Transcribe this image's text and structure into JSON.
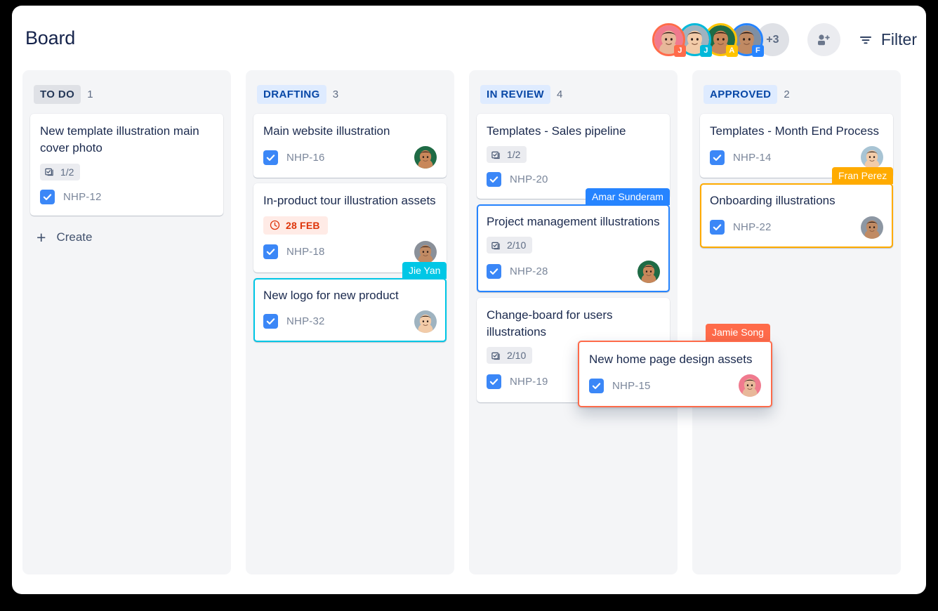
{
  "header": {
    "title": "Board",
    "filter_label": "Filter",
    "more_members": "+3",
    "members": [
      {
        "initial": "J",
        "ring": "#FF6B4A",
        "badge": "#FF6B4A",
        "skin": "#e8b89a",
        "hair": "#2b1a16",
        "bg": "#f07a8e"
      },
      {
        "initial": "J",
        "ring": "#00B8D9",
        "badge": "#00B8D9",
        "skin": "#f2cba8",
        "hair": "#1d1411",
        "bg": "#9fb3c0"
      },
      {
        "initial": "A",
        "ring": "#FFC400",
        "badge": "#FFC400",
        "skin": "#c8875a",
        "hair": "#241512",
        "bg": "#1f6b45"
      },
      {
        "initial": "F",
        "ring": "#2684FF",
        "badge": "#2684FF",
        "skin": "#c08a63",
        "hair": "#1a1010",
        "bg": "#7f8fa3"
      }
    ]
  },
  "columns": [
    {
      "name": "TO DO",
      "count": "1",
      "chip_bg": "#dfe1e6",
      "chip_fg": "#253858",
      "create_label": "Create",
      "show_create": true,
      "cards": [
        {
          "title": "New template illustration main cover photo",
          "checklist": "1/2",
          "key": "NHP-12",
          "avatar": null
        }
      ]
    },
    {
      "name": "DRAFTING",
      "count": "3",
      "chip_bg": "#deebff",
      "chip_fg": "#0747a6",
      "show_create": false,
      "cards": [
        {
          "title": "Main website illustration",
          "key": "NHP-16",
          "avatar": {
            "skin": "#c8875a",
            "hair": "#241512",
            "bg": "#1f6b45"
          }
        },
        {
          "title": "In-product tour illustration assets",
          "date": "28 FEB",
          "key": "NHP-18",
          "avatar": {
            "skin": "#c08a63",
            "hair": "#2a1a14",
            "bg": "#8a9099"
          }
        },
        {
          "title": "New logo for new product",
          "key": "NHP-32",
          "avatar": {
            "skin": "#f2cba8",
            "hair": "#1d1411",
            "bg": "#9fb3c0"
          },
          "selected": true,
          "select_color": "#00C7E6",
          "tag": "Jie Yan",
          "tag_color": "#00C7E6"
        }
      ]
    },
    {
      "name": "IN REVIEW",
      "count": "4",
      "chip_bg": "#deebff",
      "chip_fg": "#0747a6",
      "show_create": false,
      "cards": [
        {
          "title": "Templates - Sales pipeline",
          "checklist": "1/2",
          "key": "NHP-20",
          "avatar": null
        },
        {
          "title": "Project management illustrations",
          "checklist": "2/10",
          "key": "NHP-28",
          "avatar": {
            "skin": "#c8875a",
            "hair": "#241512",
            "bg": "#1f6b45"
          },
          "selected": true,
          "select_color": "#2684FF",
          "tag": "Amar Sunderam",
          "tag_color": "#2684FF"
        },
        {
          "title": "Change-board for users illustrations",
          "checklist": "2/10",
          "key": "NHP-19",
          "avatar": {
            "skin": "#c8875a",
            "hair": "#241512",
            "bg": "#1f6b45"
          }
        }
      ]
    },
    {
      "name": "APPROVED",
      "count": "2",
      "chip_bg": "#deebff",
      "chip_fg": "#0747a6",
      "show_create": false,
      "cards": [
        {
          "title": "Templates - Month End Process",
          "key": "NHP-14",
          "avatar": {
            "skin": "#f2cba8",
            "hair": "#16100e",
            "bg": "#a8c4d4"
          }
        },
        {
          "title": "Onboarding illustrations",
          "key": "NHP-22",
          "avatar": {
            "skin": "#c08a63",
            "hair": "#1a1010",
            "bg": "#8d97a3"
          },
          "selected": true,
          "select_color": "#FFAB00",
          "tag": "Fran Perez",
          "tag_color": "#FFAB00"
        }
      ]
    }
  ],
  "dragging_card": {
    "title": "New home page design assets",
    "key": "NHP-15",
    "tag": "Jamie Song",
    "tag_color": "#FF6B4A",
    "border_color": "#FF6B4A",
    "avatar": {
      "skin": "#e8b89a",
      "hair": "#2b1a16",
      "bg": "#f07a8e"
    }
  }
}
